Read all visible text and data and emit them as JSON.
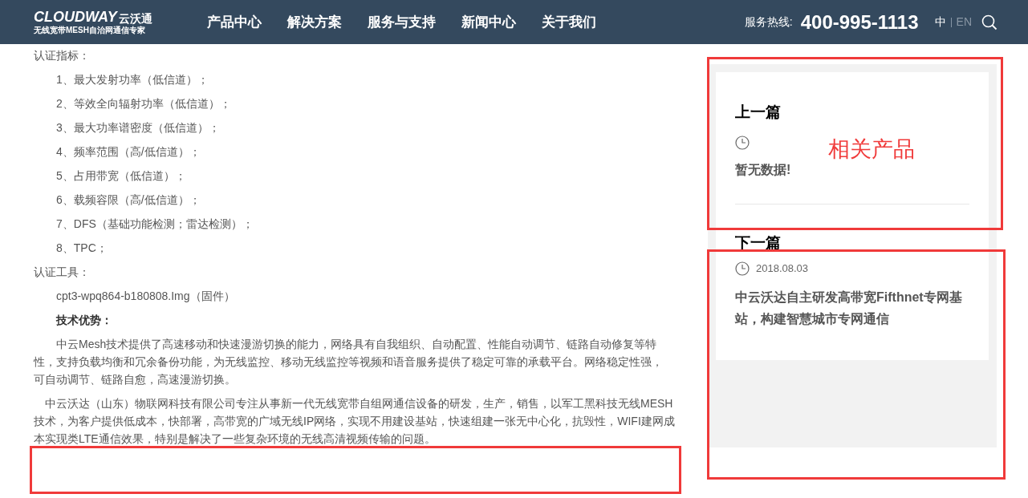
{
  "header": {
    "logo": {
      "wordmark": "CLOUDWAY",
      "cn_name": "云沃通",
      "tagline": "无线宽带MESH自治网通信专家"
    },
    "nav": [
      {
        "label": "产品中心"
      },
      {
        "label": "解决方案"
      },
      {
        "label": "服务与支持"
      },
      {
        "label": "新闻中心"
      },
      {
        "label": "关于我们"
      }
    ],
    "hotline_label": "服务热线:",
    "hotline_number": "400-995-1113",
    "languages": [
      {
        "label": "中",
        "selected": true
      },
      {
        "label": "EN",
        "selected": false
      }
    ]
  },
  "article": {
    "blocks": [
      {
        "kind": "label",
        "text": "认证指标："
      },
      {
        "kind": "item",
        "text": "1、最大发射功率（低信道）；"
      },
      {
        "kind": "item",
        "text": "2、等效全向辐射功率（低信道）；"
      },
      {
        "kind": "item",
        "text": "3、最大功率谱密度（低信道）；"
      },
      {
        "kind": "item",
        "text": "4、频率范围（高/低信道）；"
      },
      {
        "kind": "item",
        "text": "5、占用带宽（低信道）；"
      },
      {
        "kind": "item",
        "text": "6、载频容限（高/低信道）；"
      },
      {
        "kind": "item",
        "text": "7、DFS（基础功能检测；雷达检测）；"
      },
      {
        "kind": "item",
        "text": "8、TPC；"
      },
      {
        "kind": "label",
        "text": "认证工具："
      },
      {
        "kind": "item",
        "text": "cpt3-wpq864-b180808.Img（固件）"
      },
      {
        "kind": "heading",
        "text": "技术优势："
      },
      {
        "kind": "paragraph",
        "text": "中云Mesh技术提供了高速移动和快速漫游切换的能力，网络具有自我组织、自动配置、性能自动调节、链路自动修复等特性，支持负载均衡和冗余备份功能，为无线监控、移动无线监控等视频和语音服务提供了稳定可靠的承载平台。网络稳定性强，可自动调节、链路自愈，高速漫游切换。"
      },
      {
        "kind": "paragraph_small",
        "text": "中云沃达（山东）物联网科技有限公司专注从事新一代无线宽带自组网通信设备的研发，生产，销售，以军工黑科技无线MESH技术，为客户提供低成本，快部署，高带宽的广域无线IP网络，实现不用建设基站，快速组建一张无中心化，抗毁性，WIFI建网成本实现类LTE通信效果，特别是解决了一些复杂环境的无线高清视频传输的问题。"
      }
    ]
  },
  "sidebar": {
    "prev": {
      "heading": "上一篇",
      "title": "暂无数据!"
    },
    "next": {
      "heading": "下一篇",
      "date": "2018.08.03",
      "title": "中云沃达自主研发高带宽Fifthnet专网基站，构建智慧城市专网通信"
    }
  },
  "annotations": {
    "label": "相关产品"
  }
}
